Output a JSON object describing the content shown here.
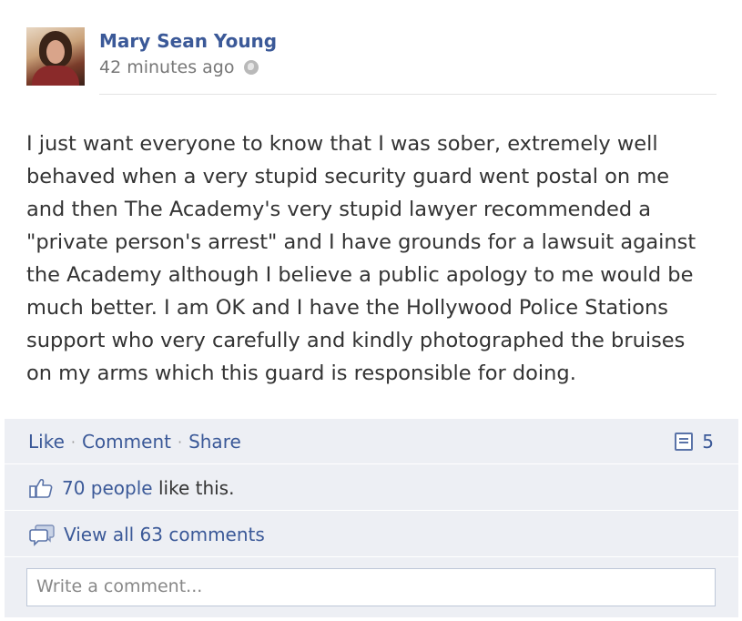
{
  "post": {
    "author": "Mary Sean Young",
    "time": "42 minutes ago",
    "message": "I just want everyone to know that I was sober, extremely well\nbehaved when a very stupid security guard went postal on me\nand then The Academy's very stupid lawyer recommended a\n\"private person's arrest\" and I have grounds for a lawsuit against\nthe Academy although I believe a public apology to me would be\nmuch better. I am OK and I have the Hollywood Police Stations\nsupport who very carefully and kindly photographed the bruises\non my arms which this guard is responsible for doing."
  },
  "actions": {
    "like": "Like",
    "comment": "Comment",
    "share": "Share",
    "separator": "·",
    "comment_count": "5"
  },
  "likes": {
    "count_text": "70 people",
    "suffix": " like this."
  },
  "comments": {
    "view_all": "View all 63 comments"
  },
  "composer": {
    "placeholder": "Write a comment..."
  },
  "icons": {
    "privacy": "globe-icon",
    "comment_count": "comment-count-icon",
    "like": "thumbs-up-icon",
    "comments": "speech-bubble-icon"
  },
  "colors": {
    "link": "#3b5998",
    "ufi_background": "#edeff4",
    "text": "#333333",
    "meta": "#777777"
  }
}
